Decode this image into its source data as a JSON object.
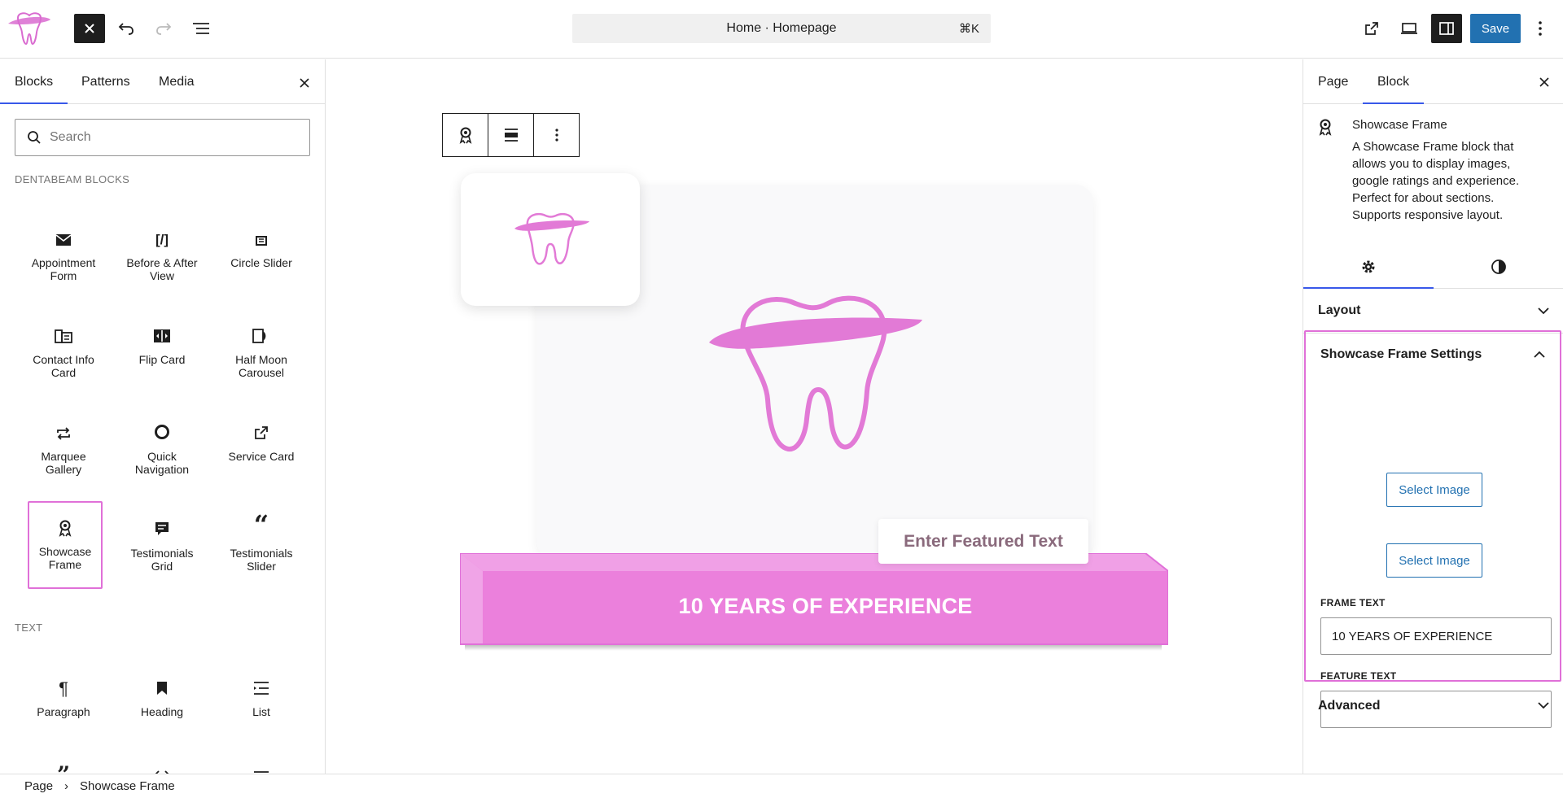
{
  "topbar": {
    "command_text": "Home · Homepage",
    "command_shortcut": "⌘K",
    "save_label": "Save"
  },
  "inserter": {
    "tabs": [
      "Blocks",
      "Patterns",
      "Media"
    ],
    "search_placeholder": "Search",
    "sections": [
      {
        "label": "DENTABEAM BLOCKS",
        "blocks": [
          {
            "label": "Appointment Form",
            "icon": "envelope-icon"
          },
          {
            "label": "Before & After View",
            "icon": "code-brackets-icon"
          },
          {
            "label": "Circle Slider",
            "icon": "slider-icon"
          },
          {
            "label": "Contact Info Card",
            "icon": "contact-card-icon"
          },
          {
            "label": "Flip Card",
            "icon": "flip-card-icon"
          },
          {
            "label": "Half Moon Carousel",
            "icon": "half-moon-icon"
          },
          {
            "label": "Marquee Gallery",
            "icon": "repeat-icon"
          },
          {
            "label": "Quick Navigation",
            "icon": "circle-icon"
          },
          {
            "label": "Service Card",
            "icon": "external-link-icon"
          },
          {
            "label": "Showcase Frame",
            "icon": "award-icon"
          },
          {
            "label": "Testimonials Grid",
            "icon": "comment-icon"
          },
          {
            "label": "Testimonials Slider",
            "icon": "quote-icon"
          }
        ]
      },
      {
        "label": "TEXT",
        "blocks": [
          {
            "label": "Paragraph",
            "icon": "paragraph-icon"
          },
          {
            "label": "Heading",
            "icon": "bookmark-icon"
          },
          {
            "label": "List",
            "icon": "list-icon"
          }
        ]
      }
    ]
  },
  "canvas": {
    "featured_text": "Enter Featured Text",
    "frame_text": "10 YEARS OF EXPERIENCE"
  },
  "sidebar": {
    "tabs": [
      "Page",
      "Block"
    ],
    "block_title": "Showcase Frame",
    "block_description": "A Showcase Frame block that allows you to display images, google ratings and experience. Perfect for about sections. Supports responsive layout.",
    "layout_label": "Layout",
    "settings_label": "Showcase Frame Settings",
    "select_image_1": "Select Image",
    "select_image_2": "Select Image",
    "frame_text_label": "FRAME TEXT",
    "frame_text_value": "10 YEARS OF EXPERIENCE",
    "feature_text_label": "FEATURE TEXT",
    "feature_text_value": "",
    "advanced_label": "Advanced"
  },
  "breadcrumb": {
    "root": "Page",
    "current": "Showcase Frame"
  },
  "colors": {
    "accent": "#3858e9",
    "save": "#2271b1",
    "brand_pink": "#e070d8",
    "plaque_pink": "#ec80db"
  }
}
